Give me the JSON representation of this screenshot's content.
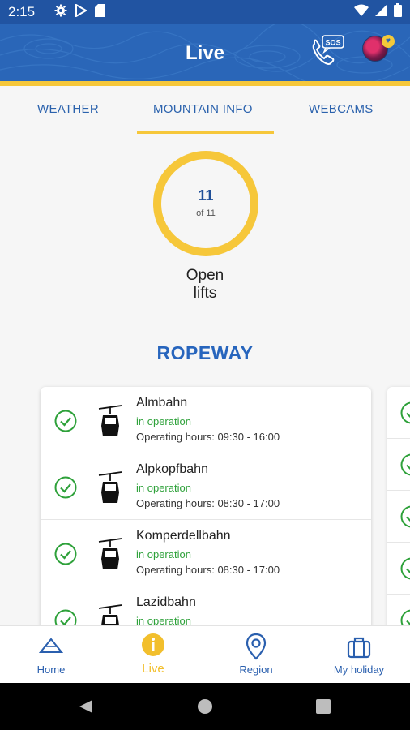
{
  "status_bar": {
    "time": "2:15"
  },
  "header": {
    "title": "Live",
    "sos_badge": "SOS"
  },
  "tabs": [
    {
      "label": "WEATHER"
    },
    {
      "label": "MOUNTAIN INFO"
    },
    {
      "label": "WEBCAMS"
    }
  ],
  "lifts_summary": {
    "open_count": "11",
    "of_total": "of 11",
    "label_line1": "Open",
    "label_line2": "lifts",
    "open_fraction": 1.0
  },
  "section": {
    "title": "ROPEWAY"
  },
  "lifts": [
    {
      "name": "Almbahn",
      "status": "in operation",
      "hours": "Operating hours: 09:30 - 16:00"
    },
    {
      "name": "Alpkopfbahn",
      "status": "in operation",
      "hours": "Operating hours: 08:30 - 17:00"
    },
    {
      "name": "Komperdellbahn",
      "status": "in operation",
      "hours": "Operating hours: 08:30 - 17:00"
    },
    {
      "name": "Lazidbahn",
      "status": "in operation",
      "hours": ""
    }
  ],
  "bottom_nav": [
    {
      "label": "Home"
    },
    {
      "label": "Live"
    },
    {
      "label": "Region"
    },
    {
      "label": "My holiday"
    }
  ],
  "colors": {
    "brand_blue": "#2a66b8",
    "accent_yellow": "#f6c73a",
    "status_green": "#2ea13a"
  }
}
